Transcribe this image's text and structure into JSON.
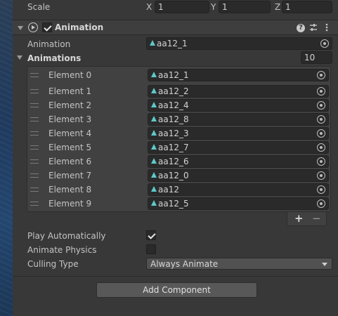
{
  "scale": {
    "label": "Scale",
    "x_label": "X",
    "x": "1",
    "y_label": "Y",
    "y": "1",
    "z_label": "Z",
    "z": "1"
  },
  "component": {
    "title": "Animation",
    "enabled": true,
    "icons": [
      "play-circle-icon",
      "help-icon",
      "settings-sliders-icon",
      "more-vert-icon"
    ]
  },
  "animation_field": {
    "label": "Animation",
    "value": "aa12_1"
  },
  "animations": {
    "label": "Animations",
    "size": "10",
    "elements": [
      {
        "label": "Element 0",
        "value": "aa12_1"
      },
      {
        "label": "Element 1",
        "value": "aa12_2"
      },
      {
        "label": "Element 2",
        "value": "aa12_4"
      },
      {
        "label": "Element 3",
        "value": "aa12_8"
      },
      {
        "label": "Element 4",
        "value": "aa12_3"
      },
      {
        "label": "Element 5",
        "value": "aa12_7"
      },
      {
        "label": "Element 6",
        "value": "aa12_6"
      },
      {
        "label": "Element 7",
        "value": "aa12_0"
      },
      {
        "label": "Element 8",
        "value": "aa12"
      },
      {
        "label": "Element 9",
        "value": "aa12_5"
      }
    ],
    "add_label": "+",
    "remove_label": "−"
  },
  "play_automatically": {
    "label": "Play Automatically",
    "checked": true
  },
  "animate_physics": {
    "label": "Animate Physics",
    "checked": false
  },
  "culling_type": {
    "label": "Culling Type",
    "value": "Always Animate"
  },
  "add_component": {
    "label": "Add Component"
  },
  "colors": {
    "clip_icon": "#5fc8c8",
    "panel_bg": "#383838",
    "field_bg": "#2a2a2a"
  }
}
